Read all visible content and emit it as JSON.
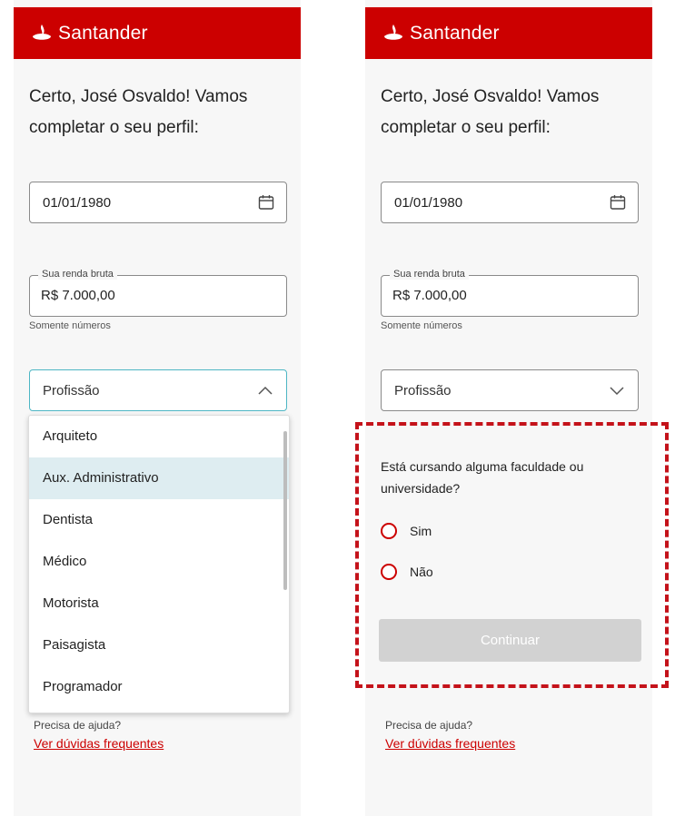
{
  "brand": {
    "name": "Santander",
    "color": "#cc0000"
  },
  "screens": [
    {
      "heading": "Certo, José Osvaldo! Vamos completar o seu perfil:",
      "date_value": "01/01/1980",
      "income_label": "Sua renda bruta",
      "income_value": "R$ 7.000,00",
      "income_helper": "Somente números",
      "profession_value": "Profissão",
      "dropdown_items": [
        "Arquiteto",
        "Aux. Administrativo",
        "Dentista",
        "Médico",
        "Motorista",
        "Paisagista",
        "Programador"
      ],
      "highlighted_item": "Aux. Administrativo",
      "help_text": "Precisa de ajuda?",
      "help_link": "Ver dúvidas frequentes"
    },
    {
      "heading": "Certo, José Osvaldo! Vamos completar o seu perfil:",
      "date_value": "01/01/1980",
      "income_label": "Sua renda bruta",
      "income_value": "R$ 7.000,00",
      "income_helper": "Somente números",
      "profession_value": "Profissão",
      "question": "Está cursando alguma faculdade ou universidade?",
      "options": [
        "Sim",
        "Não"
      ],
      "continue_label": "Continuar",
      "help_text": "Precisa de ajuda?",
      "help_link": "Ver dúvidas frequentes"
    }
  ],
  "colors": {
    "highlight_frame": "#c4121a",
    "dropdown_highlight": "#deedf1",
    "disabled_button": "#d2d2d2"
  }
}
